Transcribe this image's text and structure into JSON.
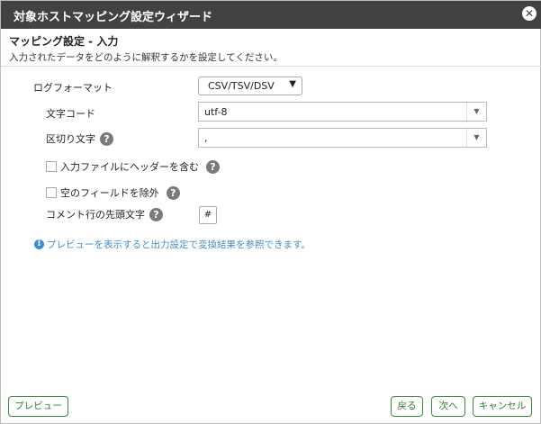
{
  "window": {
    "title": "対象ホストマッピング設定ウィザード",
    "close_icon": "close-icon"
  },
  "section": {
    "title": "マッピング設定 - 入力",
    "description": "入力されたデータをどのように解釈するかを設定してください。"
  },
  "fields": {
    "log_format": {
      "label": "ログフォーマット",
      "value": "CSV/TSV/DSV"
    },
    "charset": {
      "label": "文字コード",
      "value": "utf-8"
    },
    "delimiter": {
      "label": "区切り文字",
      "value": ","
    },
    "header_included": {
      "label": "入力ファイルにヘッダーを含む",
      "checked": false
    },
    "exclude_empty": {
      "label": "空のフィールドを除外",
      "checked": false
    },
    "comment_prefix": {
      "label": "コメント行の先頭文字",
      "value": "#"
    }
  },
  "help_glyph": "?",
  "info": {
    "glyph": "i",
    "text": "プレビューを表示すると出力設定で変換結果を参照できます。"
  },
  "buttons": {
    "preview": "プレビュー",
    "back": "戻る",
    "next": "次へ",
    "cancel": "キャンセル"
  },
  "colors": {
    "titlebar": "#424242",
    "button_accent": "#2e7d32",
    "info_text": "#4a8dc0"
  }
}
